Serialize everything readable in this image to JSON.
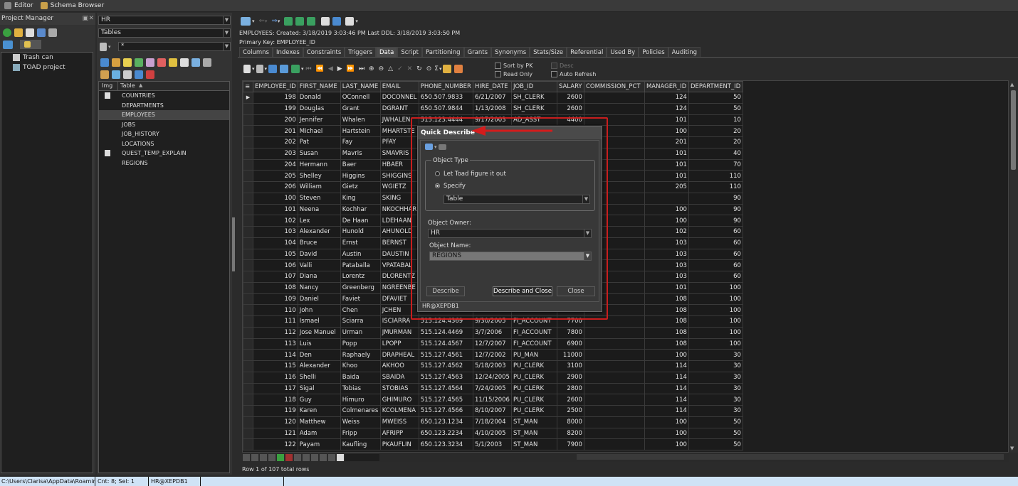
{
  "top_tabs": [
    "Editor",
    "Schema Browser"
  ],
  "project_manager": {
    "title": "Project Manager",
    "tree": [
      "Trash can",
      "TOAD project"
    ]
  },
  "object_list": {
    "schema": "HR",
    "object_type": "Tables",
    "filter": "*",
    "columns": [
      "Img",
      "Table"
    ],
    "tables": [
      "COUNTRIES",
      "DEPARTMENTS",
      "EMPLOYEES",
      "JOBS",
      "JOB_HISTORY",
      "LOCATIONS",
      "QUEST_TEMP_EXPLAIN",
      "REGIONS"
    ],
    "selected": "EMPLOYEES"
  },
  "object_info": {
    "line1": "EMPLOYEES:  Created: 3/18/2019 3:03:46 PM   Last DDL: 3/18/2019 3:03:50 PM",
    "line2": "Primary Key:  EMPLOYEE_ID"
  },
  "detail_tabs": [
    "Columns",
    "Indexes",
    "Constraints",
    "Triggers",
    "Data",
    "Script",
    "Partitioning",
    "Grants",
    "Synonyms",
    "Stats/Size",
    "Referential",
    "Used By",
    "Policies",
    "Auditing"
  ],
  "active_tab": "Data",
  "options": {
    "sort_by_pk": "Sort by PK",
    "read_only": "Read Only",
    "desc": "Desc",
    "auto_refresh": "Auto Refresh"
  },
  "grid": {
    "columns": [
      "EMPLOYEE_ID",
      "FIRST_NAME",
      "LAST_NAME",
      "EMAIL",
      "PHONE_NUMBER",
      "HIRE_DATE",
      "JOB_ID",
      "SALARY",
      "COMMISSION_PCT",
      "MANAGER_ID",
      "DEPARTMENT_ID"
    ],
    "rows": [
      [
        "198",
        "Donald",
        "OConnell",
        "DOCONNEL",
        "650.507.9833",
        "6/21/2007",
        "SH_CLERK",
        "2600",
        "",
        "124",
        "50"
      ],
      [
        "199",
        "Douglas",
        "Grant",
        "DGRANT",
        "650.507.9844",
        "1/13/2008",
        "SH_CLERK",
        "2600",
        "",
        "124",
        "50"
      ],
      [
        "200",
        "Jennifer",
        "Whalen",
        "JWHALEN",
        "515.123.4444",
        "9/17/2003",
        "AD_ASST",
        "4400",
        "",
        "101",
        "10"
      ],
      [
        "201",
        "Michael",
        "Hartstein",
        "MHARTSTE",
        "",
        "",
        "",
        "",
        "",
        "100",
        "20"
      ],
      [
        "202",
        "Pat",
        "Fay",
        "PFAY",
        "",
        "",
        "",
        "",
        "",
        "201",
        "20"
      ],
      [
        "203",
        "Susan",
        "Mavris",
        "SMAVRIS",
        "",
        "",
        "",
        "",
        "",
        "101",
        "40"
      ],
      [
        "204",
        "Hermann",
        "Baer",
        "HBAER",
        "",
        "",
        "",
        "",
        "",
        "101",
        "70"
      ],
      [
        "205",
        "Shelley",
        "Higgins",
        "SHIGGINS",
        "",
        "",
        "",
        "",
        "",
        "101",
        "110"
      ],
      [
        "206",
        "William",
        "Gietz",
        "WGIETZ",
        "",
        "",
        "",
        "",
        "",
        "205",
        "110"
      ],
      [
        "100",
        "Steven",
        "King",
        "SKING",
        "",
        "",
        "",
        "",
        "",
        "",
        "90"
      ],
      [
        "101",
        "Neena",
        "Kochhar",
        "NKOCHHAR",
        "",
        "",
        "",
        "",
        "",
        "100",
        "90"
      ],
      [
        "102",
        "Lex",
        "De Haan",
        "LDEHAAN",
        "",
        "",
        "",
        "",
        "",
        "100",
        "90"
      ],
      [
        "103",
        "Alexander",
        "Hunold",
        "AHUNOLD",
        "",
        "",
        "",
        "",
        "",
        "102",
        "60"
      ],
      [
        "104",
        "Bruce",
        "Ernst",
        "BERNST",
        "",
        "",
        "",
        "",
        "",
        "103",
        "60"
      ],
      [
        "105",
        "David",
        "Austin",
        "DAUSTIN",
        "",
        "",
        "",
        "",
        "",
        "103",
        "60"
      ],
      [
        "106",
        "Valli",
        "Pataballa",
        "VPATABAL",
        "",
        "",
        "",
        "",
        "",
        "103",
        "60"
      ],
      [
        "107",
        "Diana",
        "Lorentz",
        "DLORENTZ",
        "",
        "",
        "",
        "",
        "",
        "103",
        "60"
      ],
      [
        "108",
        "Nancy",
        "Greenberg",
        "NGREENBE",
        "",
        "",
        "",
        "",
        "",
        "101",
        "100"
      ],
      [
        "109",
        "Daniel",
        "Faviet",
        "DFAVIET",
        "",
        "",
        "",
        "",
        "",
        "108",
        "100"
      ],
      [
        "110",
        "John",
        "Chen",
        "JCHEN",
        "",
        "",
        "",
        "",
        "",
        "108",
        "100"
      ],
      [
        "111",
        "Ismael",
        "Sciarra",
        "ISCIARRA",
        "515.124.4369",
        "9/30/2005",
        "FI_ACCOUNT",
        "7700",
        "",
        "108",
        "100"
      ],
      [
        "112",
        "Jose Manuel",
        "Urman",
        "JMURMAN",
        "515.124.4469",
        "3/7/2006",
        "FI_ACCOUNT",
        "7800",
        "",
        "108",
        "100"
      ],
      [
        "113",
        "Luis",
        "Popp",
        "LPOPP",
        "515.124.4567",
        "12/7/2007",
        "FI_ACCOUNT",
        "6900",
        "",
        "108",
        "100"
      ],
      [
        "114",
        "Den",
        "Raphaely",
        "DRAPHEAL",
        "515.127.4561",
        "12/7/2002",
        "PU_MAN",
        "11000",
        "",
        "100",
        "30"
      ],
      [
        "115",
        "Alexander",
        "Khoo",
        "AKHOO",
        "515.127.4562",
        "5/18/2003",
        "PU_CLERK",
        "3100",
        "",
        "114",
        "30"
      ],
      [
        "116",
        "Shelli",
        "Baida",
        "SBAIDA",
        "515.127.4563",
        "12/24/2005",
        "PU_CLERK",
        "2900",
        "",
        "114",
        "30"
      ],
      [
        "117",
        "Sigal",
        "Tobias",
        "STOBIAS",
        "515.127.4564",
        "7/24/2005",
        "PU_CLERK",
        "2800",
        "",
        "114",
        "30"
      ],
      [
        "118",
        "Guy",
        "Himuro",
        "GHIMURO",
        "515.127.4565",
        "11/15/2006",
        "PU_CLERK",
        "2600",
        "",
        "114",
        "30"
      ],
      [
        "119",
        "Karen",
        "Colmenares",
        "KCOLMENA",
        "515.127.4566",
        "8/10/2007",
        "PU_CLERK",
        "2500",
        "",
        "114",
        "30"
      ],
      [
        "120",
        "Matthew",
        "Weiss",
        "MWEISS",
        "650.123.1234",
        "7/18/2004",
        "ST_MAN",
        "8000",
        "",
        "100",
        "50"
      ],
      [
        "121",
        "Adam",
        "Fripp",
        "AFRIPP",
        "650.123.2234",
        "4/10/2005",
        "ST_MAN",
        "8200",
        "",
        "100",
        "50"
      ],
      [
        "122",
        "Payam",
        "Kaufling",
        "PKAUFLIN",
        "650.123.3234",
        "5/1/2003",
        "ST_MAN",
        "7900",
        "",
        "100",
        "50"
      ]
    ],
    "row_status": "Row 1 of 107 total rows"
  },
  "dialog": {
    "title": "Quick Describe",
    "object_type_label": "Object Type",
    "radio_auto": "Let Toad figure it out",
    "radio_specify": "Specify",
    "type_value": "Table",
    "owner_label": "Object Owner:",
    "owner_value": "HR",
    "name_label": "Object Name:",
    "name_value": "REGIONS",
    "btn_describe": "Describe",
    "btn_describe_close": "Describe and Close",
    "btn_close": "Close",
    "footer": "HR@XEPDB1"
  },
  "status_bar": {
    "path": "C:\\Users\\Clarisa\\AppData\\Roaming\\",
    "counts": "Cnt: 8; Sel: 1",
    "connection": "HR@XEPDB1"
  },
  "colors": {
    "highlight": "#c81e1e",
    "status_bg": "#cfe3f6"
  }
}
